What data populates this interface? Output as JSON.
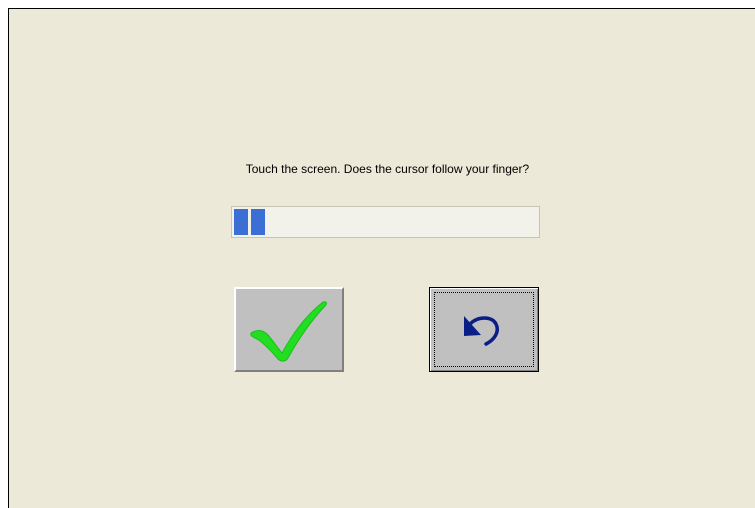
{
  "dialog": {
    "prompt": "Touch the screen. Does the cursor follow your finger?",
    "progress_percent": 13,
    "buttons": [
      {
        "name": "confirm",
        "icon": "checkmark-icon",
        "icon_color": "#22dd22"
      },
      {
        "name": "retry",
        "icon": "undo-arrow-icon",
        "icon_color": "#0a1e88"
      }
    ]
  },
  "colors": {
    "background": "#ece9d8",
    "progress_fill": "#3b6fd5",
    "button_face": "#c0c0c0"
  }
}
